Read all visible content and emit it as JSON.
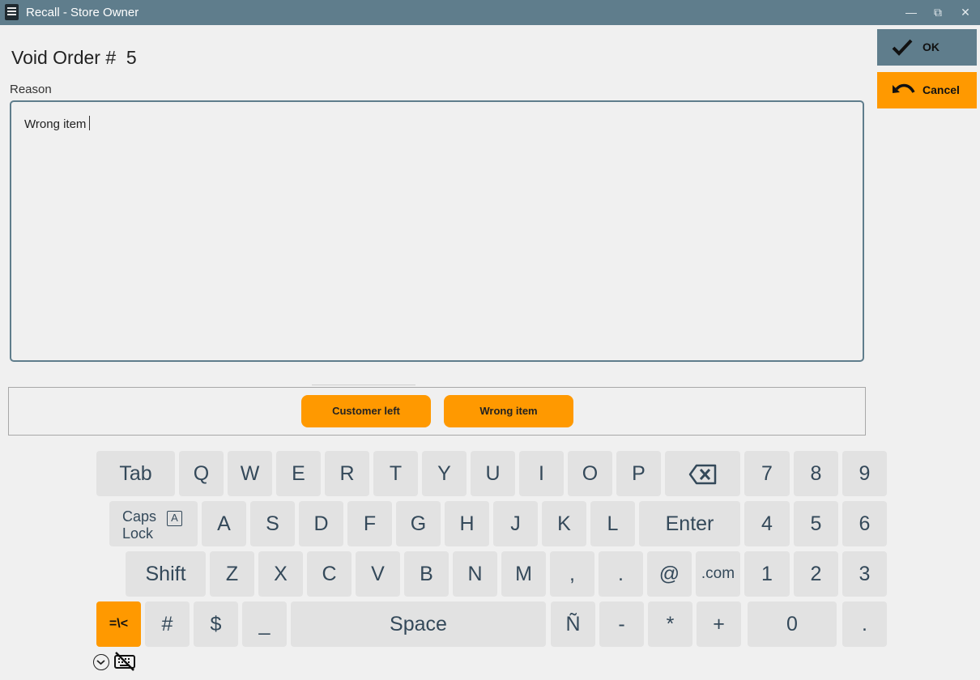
{
  "window": {
    "title": "Recall - Store Owner",
    "controls": {
      "minimize": "—",
      "restore": "⧉",
      "close": "✕"
    }
  },
  "page": {
    "title": "Void Order #  5",
    "reason_label": "Reason",
    "reason_value": "Wrong item"
  },
  "actions": {
    "ok": "OK",
    "cancel": "Cancel"
  },
  "presets": [
    "Customer left",
    "Wrong item"
  ],
  "keyboard": {
    "row1": [
      "Tab",
      "Q",
      "W",
      "E",
      "R",
      "T",
      "Y",
      "U",
      "I",
      "O",
      "P",
      "backspace",
      "7",
      "8",
      "9"
    ],
    "row2": [
      "Caps Lock",
      "A",
      "S",
      "D",
      "F",
      "G",
      "H",
      "J",
      "K",
      "L",
      "Enter",
      "4",
      "5",
      "6"
    ],
    "row3": [
      "Shift",
      "Z",
      "X",
      "C",
      "V",
      "B",
      "N",
      "M",
      ",",
      ".",
      "@",
      ".com",
      "1",
      "2",
      "3"
    ],
    "row4": [
      "=\\<",
      "#",
      "$",
      "_",
      "Space",
      "Ñ",
      "-",
      "*",
      "+",
      "0",
      "."
    ],
    "caps_line1": "Caps",
    "caps_line2": "Lock",
    "caps_indicator": "A"
  },
  "colors": {
    "titlebar": "#5f7d8c",
    "accent_orange": "#ff9900",
    "key_bg": "#e2e2e2",
    "key_text": "#34495a"
  },
  "icons": {
    "app": "register-icon",
    "ok": "checkmark-icon",
    "cancel": "undo-arrow-icon",
    "backspace": "backspace-icon",
    "keyboard_toggle": "chevron-down-circle-icon",
    "keyboard_hide": "keyboard-off-icon"
  }
}
